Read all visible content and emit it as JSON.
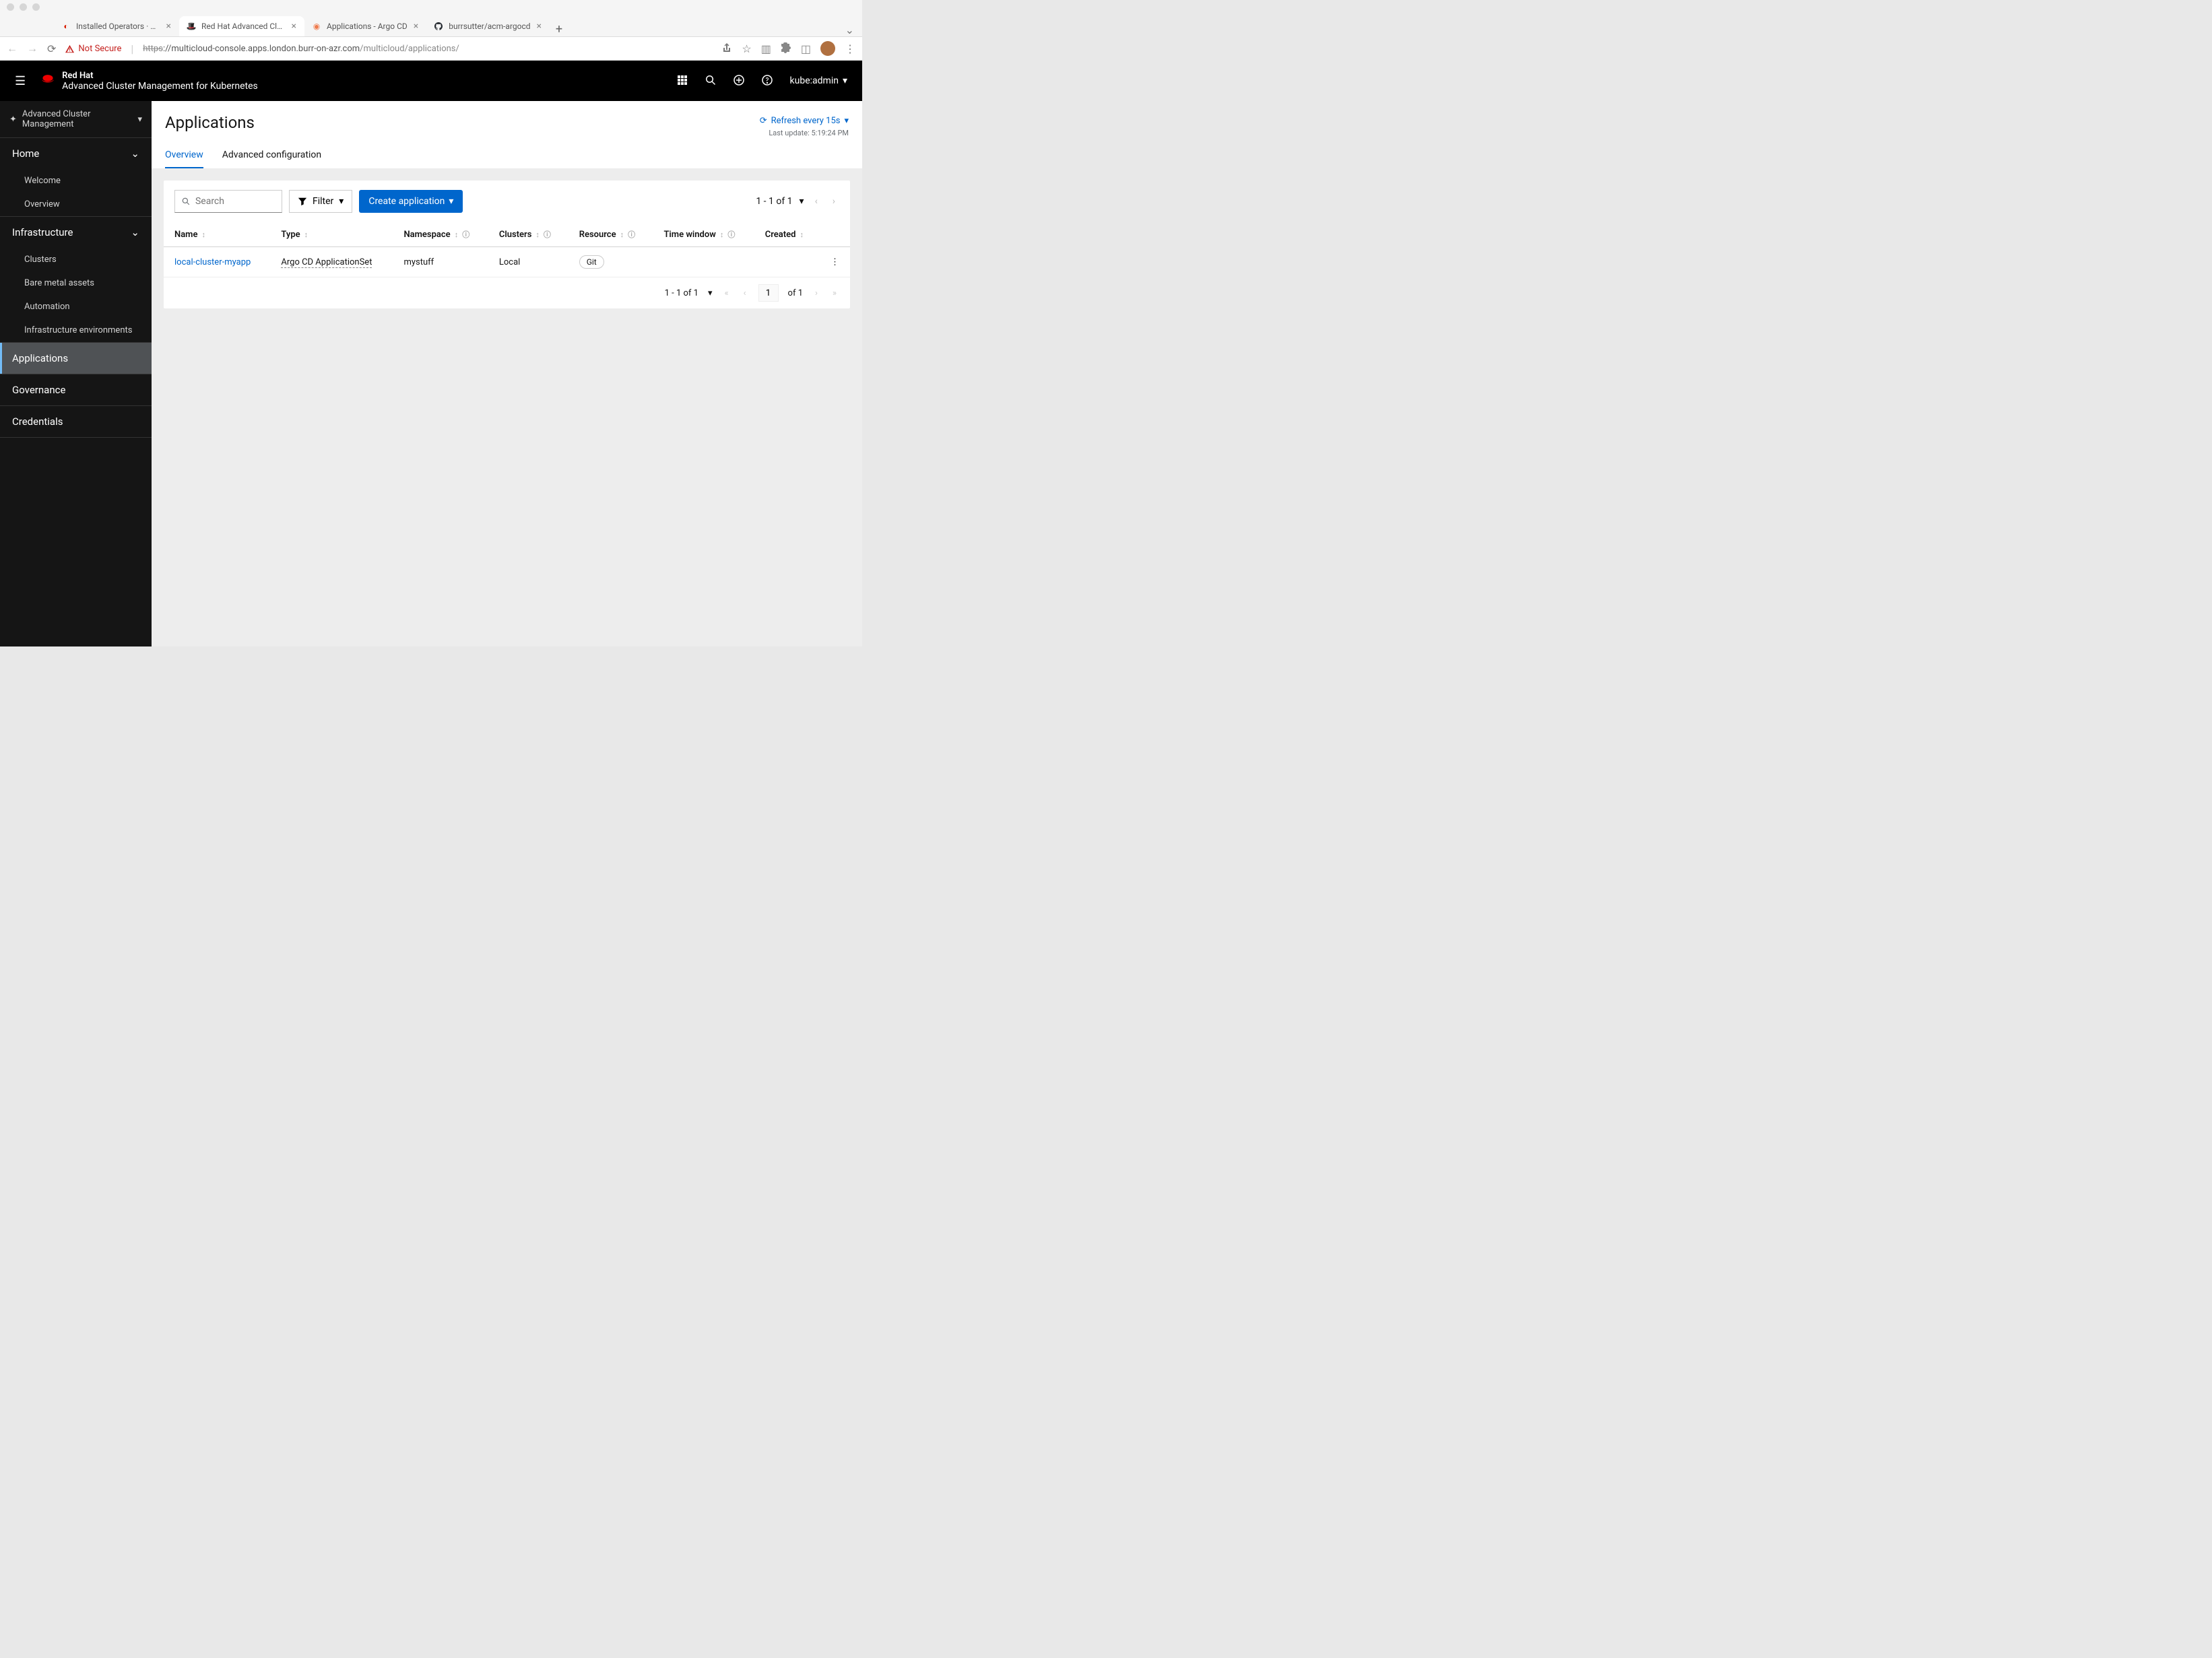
{
  "browser": {
    "tabs": [
      {
        "title": "Installed Operators · Red Hat O",
        "favicon_color": "#d71e00"
      },
      {
        "title": "Red Hat Advanced Cluster Man",
        "favicon_color": "#d71e00",
        "active": true
      },
      {
        "title": "Applications - Argo CD",
        "favicon_color": "#ef7b4d"
      },
      {
        "title": "burrsutter/acm-argocd",
        "favicon_color": "#24292f"
      }
    ],
    "security_label": "Not Secure",
    "url_struck": "https",
    "url_host": "://multicloud-console.apps.london.burr-on-azr.com",
    "url_path": "/multicloud/applications/"
  },
  "masthead": {
    "brand_top": "Red Hat",
    "brand_bottom": "Advanced Cluster Management for Kubernetes",
    "user": "kube:admin"
  },
  "sidebar": {
    "perspective": "Advanced Cluster Management",
    "home": {
      "label": "Home",
      "items": [
        {
          "label": "Welcome"
        },
        {
          "label": "Overview"
        }
      ]
    },
    "infra": {
      "label": "Infrastructure",
      "items": [
        {
          "label": "Clusters"
        },
        {
          "label": "Bare metal assets"
        },
        {
          "label": "Automation"
        },
        {
          "label": "Infrastructure environments"
        }
      ]
    },
    "applications": "Applications",
    "governance": "Governance",
    "credentials": "Credentials"
  },
  "page": {
    "title": "Applications",
    "refresh_label": "Refresh every 15s",
    "last_update": "Last update: 5:19:24 PM",
    "tabs": [
      {
        "label": "Overview",
        "active": true
      },
      {
        "label": "Advanced configuration"
      }
    ],
    "search_placeholder": "Search",
    "filter_label": "Filter",
    "create_label": "Create application",
    "top_pager": "1 - 1 of 1",
    "columns": {
      "name": "Name",
      "type": "Type",
      "namespace": "Namespace",
      "clusters": "Clusters",
      "resource": "Resource",
      "time_window": "Time window",
      "created": "Created"
    },
    "rows": [
      {
        "name": "local-cluster-myapp",
        "type": "Argo CD ApplicationSet",
        "namespace": "mystuff",
        "clusters": "Local",
        "resource": "Git",
        "time_window": "",
        "created": ""
      }
    ],
    "footer": {
      "range": "1 - 1 of 1",
      "page_input": "1",
      "of_total": "of 1"
    }
  }
}
